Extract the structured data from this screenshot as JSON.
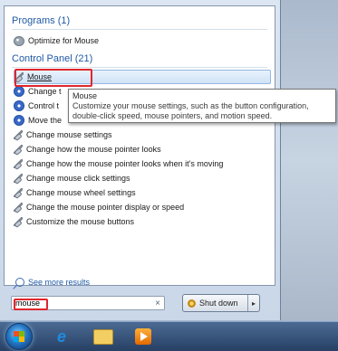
{
  "programs": {
    "header": "Programs (1)",
    "items": [
      {
        "label": "Optimize for Mouse",
        "icon": "optimize-icon"
      }
    ]
  },
  "control_panel": {
    "header": "Control Panel (21)",
    "items": [
      {
        "label": "Mouse",
        "icon": "mouse-icon",
        "highlighted": true
      },
      {
        "label": "Change t",
        "icon": "shield-icon"
      },
      {
        "label": "Control t",
        "icon": "shield-icon"
      },
      {
        "label": "Move the",
        "icon": "shield-icon"
      },
      {
        "label": "Change mouse settings",
        "icon": "mouse-icon"
      },
      {
        "label": "Change how the mouse pointer looks",
        "icon": "mouse-icon"
      },
      {
        "label": "Change how the mouse pointer looks when it's moving",
        "icon": "mouse-icon"
      },
      {
        "label": "Change mouse click settings",
        "icon": "mouse-icon"
      },
      {
        "label": "Change mouse wheel settings",
        "icon": "mouse-icon"
      },
      {
        "label": "Change the mouse pointer display or speed",
        "icon": "mouse-icon"
      },
      {
        "label": "Customize the mouse buttons",
        "icon": "mouse-icon"
      }
    ]
  },
  "tooltip": {
    "title": "Mouse",
    "text": "Customize your mouse settings, such as the button configuration, double-click speed, mouse pointers, and motion speed."
  },
  "see_more": "See more results",
  "search": {
    "value": "mouse",
    "clear": "×"
  },
  "shutdown": {
    "label": "Shut down",
    "arrow": "▸"
  },
  "taskbar": {
    "icons": [
      "start-orb",
      "internet-explorer-icon",
      "windows-explorer-icon",
      "media-player-icon"
    ]
  },
  "colors": {
    "highlight_border": "#e0262e",
    "header_blue": "#1e5aa6"
  }
}
